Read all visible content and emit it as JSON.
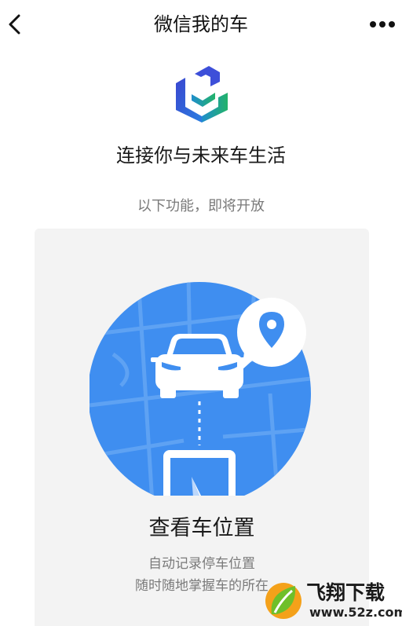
{
  "nav": {
    "title": "微信我的车",
    "back_icon": "chevron-left-icon",
    "more_icon": "more-dots-icon"
  },
  "logo": {
    "icon": "car-brand-logo-icon",
    "colors": [
      "#3a57d8",
      "#1aa36f"
    ]
  },
  "headline": "连接你与未来车生活",
  "subline": "以下功能，即将开放",
  "feature_card": {
    "title": "查看车位置",
    "description_line1": "自动记录停车位置",
    "description_line2": "随时随地掌握车的所在",
    "illustration_icons": [
      "map-circle",
      "car-icon",
      "location-pin-icon",
      "phone-compass-icon"
    ],
    "accent_color": "#3f8ef0"
  },
  "watermark": {
    "name": "飞翔下载",
    "site": "www.52z.com"
  }
}
